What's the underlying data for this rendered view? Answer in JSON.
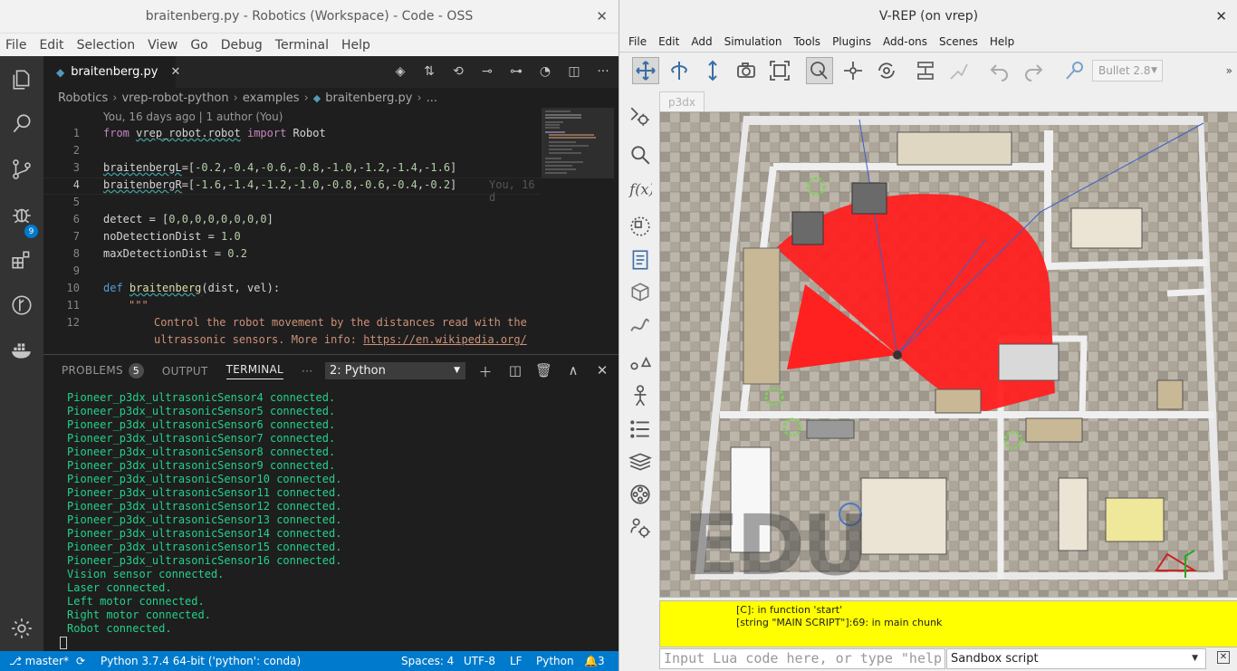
{
  "vscode": {
    "window_title": "braitenberg.py - Robotics (Workspace) - Code - OSS",
    "menu": [
      "File",
      "Edit",
      "Selection",
      "View",
      "Go",
      "Debug",
      "Terminal",
      "Help"
    ],
    "scm_badge": "9",
    "tab": {
      "label": "braitenberg.py",
      "icon": "python-file-icon"
    },
    "breadcrumb": [
      "Robotics",
      "vrep-robot-python",
      "examples",
      "braitenberg.py",
      "..."
    ],
    "codelens": "You, 16 days ago | 1 author (You)",
    "line_numbers": [
      "1",
      "2",
      "3",
      "4",
      "5",
      "6",
      "7",
      "8",
      "9",
      "10",
      "11",
      "12"
    ],
    "code": {
      "l1": [
        "from",
        " ",
        "vrep_robot.robot",
        " ",
        "import",
        " Robot"
      ],
      "l3": [
        "braitenbergL",
        "=[",
        "-0.2",
        ",",
        "-0.4",
        ",",
        "-0.6",
        ",",
        "-0.8",
        ",",
        "-1.0",
        ",",
        "-1.2",
        ",",
        "-1.4",
        ",",
        "-1.6",
        "]"
      ],
      "l4": [
        "braitenbergR",
        "=[",
        "-1.6",
        ",",
        "-1.4",
        ",",
        "-1.2",
        ",",
        "-1.0",
        ",",
        "-0.8",
        ",",
        "-0.6",
        ",",
        "-0.4",
        ",",
        "-0.2",
        "]"
      ],
      "l4_blame": "You, 16 d",
      "l6": [
        "detect = [",
        "0,0,0,0,0,0,0,0",
        "]"
      ],
      "l7": [
        "noDetectionDist = ",
        "1.0"
      ],
      "l8": [
        "maxDetectionDist = ",
        "0.2"
      ],
      "l10": [
        "def",
        " ",
        "braitenberg",
        "(dist, vel):"
      ],
      "l11": "\"\"\"",
      "l12a": "Control the robot movement by the distances read with the",
      "l12b_text": "ultrassonic sensors. More info: ",
      "l12b_link": "https://en.wikipedia.org/"
    },
    "panel": {
      "tabs": [
        "PROBLEMS",
        "OUTPUT",
        "TERMINAL"
      ],
      "problems_count": "5",
      "more": "···",
      "terminal_select": "2: Python",
      "terminal_lines": [
        "Pioneer_p3dx_ultrasonicSensor4 connected.",
        "Pioneer_p3dx_ultrasonicSensor5 connected.",
        "Pioneer_p3dx_ultrasonicSensor6 connected.",
        "Pioneer_p3dx_ultrasonicSensor7 connected.",
        "Pioneer_p3dx_ultrasonicSensor8 connected.",
        "Pioneer_p3dx_ultrasonicSensor9 connected.",
        "Pioneer_p3dx_ultrasonicSensor10 connected.",
        "Pioneer_p3dx_ultrasonicSensor11 connected.",
        "Pioneer_p3dx_ultrasonicSensor12 connected.",
        "Pioneer_p3dx_ultrasonicSensor13 connected.",
        "Pioneer_p3dx_ultrasonicSensor14 connected.",
        "Pioneer_p3dx_ultrasonicSensor15 connected.",
        "Pioneer_p3dx_ultrasonicSensor16 connected.",
        "Vision sensor connected.",
        "Laser connected.",
        "Left motor connected.",
        "Right motor connected.",
        "Robot connected."
      ]
    },
    "status": {
      "branch": "master*",
      "interpreter": "Python 3.7.4 64-bit ('python': conda)",
      "spaces": "Spaces: 4",
      "encoding": "UTF-8",
      "eol": "LF",
      "language": "Python",
      "notifications": "3"
    },
    "colors": {
      "accent": "#007acc",
      "terminal_text": "#23d18b",
      "editor_bg": "#1e1e1e"
    }
  },
  "vrep": {
    "window_title": "V-REP (on vrep)",
    "menu": [
      "File",
      "Edit",
      "Add",
      "Simulation",
      "Tools",
      "Plugins",
      "Add-ons",
      "Scenes",
      "Help"
    ],
    "engine": "Bullet 2.8",
    "scene_tab": "p3dx",
    "watermark": "EDU",
    "console_lines": [
      "[C]: in function 'start'",
      "[string \"MAIN SCRIPT\"]:69: in main chunk"
    ],
    "lua_placeholder": "Input Lua code here, or type \"help()\" (use TAB for auto-completion)",
    "sandbox_select": "Sandbox script",
    "colors": {
      "sensor_cone": "#ff2020",
      "console_bg": "#ffff00"
    }
  }
}
